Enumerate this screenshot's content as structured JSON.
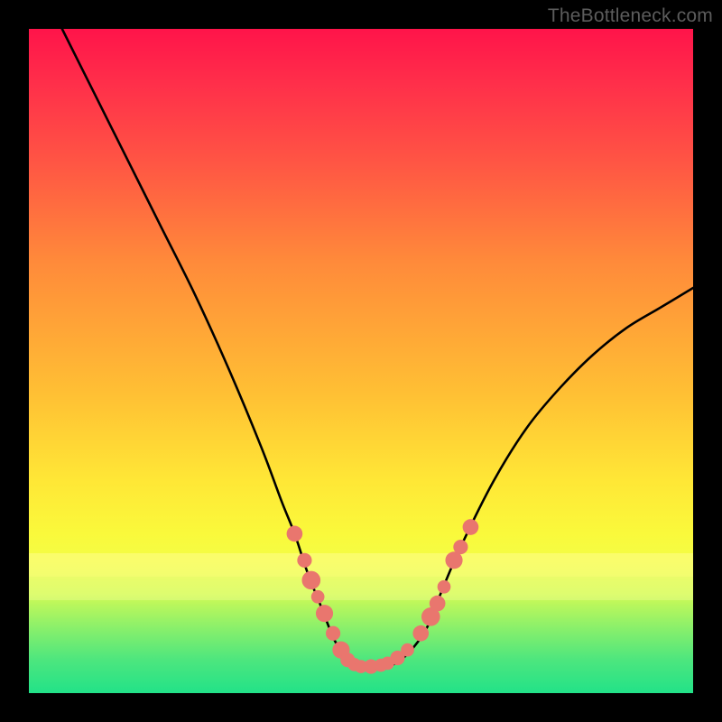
{
  "watermark": "TheBottleneck.com",
  "chart_data": {
    "type": "line",
    "title": "",
    "xlabel": "",
    "ylabel": "",
    "xlim": [
      0,
      100
    ],
    "ylim": [
      0,
      100
    ],
    "grid": false,
    "legend": false,
    "series": [
      {
        "name": "bottleneck-curve",
        "x": [
          5,
          10,
          15,
          20,
          25,
          30,
          35,
          38,
          40,
          42,
          44,
          46,
          48,
          50,
          52,
          54,
          56,
          58,
          60,
          62,
          65,
          70,
          75,
          80,
          85,
          90,
          95,
          100
        ],
        "y": [
          100,
          90,
          80,
          70,
          60,
          49,
          37,
          29,
          24,
          18,
          13,
          8,
          5,
          4,
          4,
          4,
          5,
          7,
          10,
          15,
          22,
          32,
          40,
          46,
          51,
          55,
          58,
          61
        ]
      }
    ],
    "markers": {
      "name": "highlight-dots",
      "points": [
        {
          "x": 40.0,
          "y": 24.0,
          "r": 1.2
        },
        {
          "x": 41.5,
          "y": 20.0,
          "r": 1.1
        },
        {
          "x": 42.5,
          "y": 17.0,
          "r": 1.4
        },
        {
          "x": 43.5,
          "y": 14.5,
          "r": 1.0
        },
        {
          "x": 44.5,
          "y": 12.0,
          "r": 1.3
        },
        {
          "x": 45.8,
          "y": 9.0,
          "r": 1.1
        },
        {
          "x": 47.0,
          "y": 6.5,
          "r": 1.3
        },
        {
          "x": 48.0,
          "y": 5.0,
          "r": 1.1
        },
        {
          "x": 49.0,
          "y": 4.3,
          "r": 1.0
        },
        {
          "x": 50.0,
          "y": 4.0,
          "r": 1.0
        },
        {
          "x": 51.5,
          "y": 4.0,
          "r": 1.1
        },
        {
          "x": 53.0,
          "y": 4.2,
          "r": 1.0
        },
        {
          "x": 54.0,
          "y": 4.5,
          "r": 1.0
        },
        {
          "x": 55.5,
          "y": 5.3,
          "r": 1.1
        },
        {
          "x": 57.0,
          "y": 6.5,
          "r": 1.0
        },
        {
          "x": 59.0,
          "y": 9.0,
          "r": 1.2
        },
        {
          "x": 60.5,
          "y": 11.5,
          "r": 1.4
        },
        {
          "x": 61.5,
          "y": 13.5,
          "r": 1.2
        },
        {
          "x": 62.5,
          "y": 16.0,
          "r": 1.0
        },
        {
          "x": 64.0,
          "y": 20.0,
          "r": 1.3
        },
        {
          "x": 65.0,
          "y": 22.0,
          "r": 1.1
        },
        {
          "x": 66.5,
          "y": 25.0,
          "r": 1.2
        }
      ]
    },
    "background": {
      "type": "vertical-gradient",
      "stops": [
        {
          "pos": 0.0,
          "color": "#ff144a"
        },
        {
          "pos": 0.35,
          "color": "#ff8a3a"
        },
        {
          "pos": 0.7,
          "color": "#ffe736"
        },
        {
          "pos": 1.0,
          "color": "#22e288"
        }
      ]
    }
  }
}
